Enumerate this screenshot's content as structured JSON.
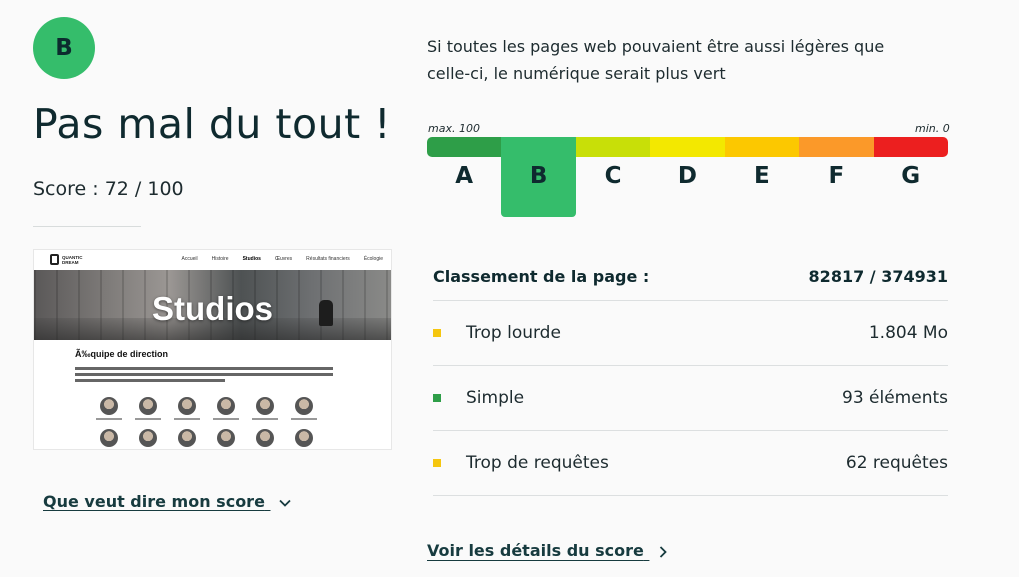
{
  "result": {
    "grade": "B",
    "headline": "Pas mal du tout !",
    "score_text": "Score : 72 / 100",
    "explain_link": "Que veut dire mon score"
  },
  "thumbnail": {
    "logo_text": "QUANTIC DREAM",
    "menu": [
      "Accueil",
      "Histoire",
      "Studios",
      "Œuvres",
      "Résultats financiers",
      "Écologie"
    ],
    "hero_title": "Studios",
    "section_title": "Ã‰quipe de direction",
    "people_count": 12
  },
  "intro": "Si toutes les pages web pouvaient être aussi légères que celle-ci, le numérique serait plus vert",
  "scale": {
    "max_label": "max. 100",
    "min_label": "min. 0",
    "grades": [
      "A",
      "B",
      "C",
      "D",
      "E",
      "F",
      "G"
    ],
    "colors": [
      "#2e9e48",
      "#35bd6b",
      "#c8df08",
      "#f3e800",
      "#fcc800",
      "#fb9929",
      "#ec1f1f"
    ],
    "active_index": 1
  },
  "ranking": {
    "label": "Classement de la page :",
    "value": "82817 / 374931"
  },
  "metrics": [
    {
      "label": "Trop lourde",
      "value": "1.804 Mo",
      "color": "#f5c60f"
    },
    {
      "label": "Simple",
      "value": "93 éléments",
      "color": "#2e9e48"
    },
    {
      "label": "Trop de requêtes",
      "value": "62 requêtes",
      "color": "#f5c60f"
    }
  ],
  "details_link": "Voir les détails du score"
}
